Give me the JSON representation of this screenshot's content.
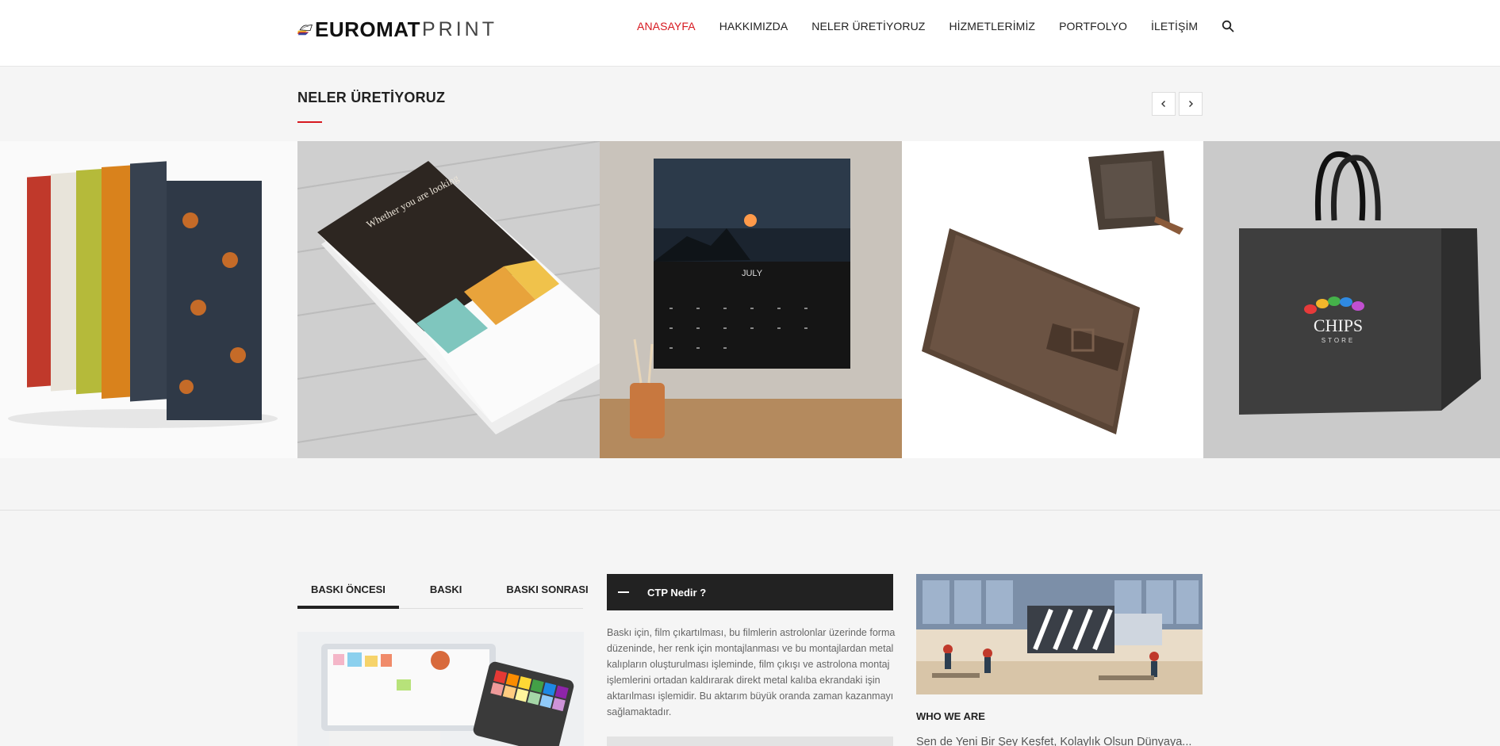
{
  "header": {
    "logo": {
      "bold": "EUROMAT",
      "light": "PRINT"
    },
    "nav": [
      {
        "label": "ANASAYFA",
        "active": true
      },
      {
        "label": "HAKKIMIZDA",
        "active": false
      },
      {
        "label": "NELER ÜRETİYORUZ",
        "active": false
      },
      {
        "label": "HİZMETLERİMİZ",
        "active": false
      },
      {
        "label": "PORTFOLYO",
        "active": false
      },
      {
        "label": "İLETİŞİM",
        "active": false
      }
    ],
    "search_icon": "search-icon"
  },
  "products": {
    "title": "NELER ÜRETİYORUZ",
    "prev_icon": "chevron-left-icon",
    "next_icon": "chevron-right-icon",
    "slides": [
      {
        "subject": "books"
      },
      {
        "subject": "brochures"
      },
      {
        "subject": "wall-calendar",
        "month": "JULY"
      },
      {
        "subject": "leather-notebook"
      },
      {
        "subject": "shopping-bag",
        "brand": "CHIPS",
        "brand_sub": "STORE"
      }
    ]
  },
  "services": {
    "tabs": [
      {
        "label": "BASKI ÖNCESI",
        "active": true
      },
      {
        "label": "BASKI",
        "active": false
      },
      {
        "label": "BASKI SONRASI",
        "active": false
      }
    ]
  },
  "faq": {
    "title": "CTP Nedir ?",
    "body": "Baskı için, film çıkartılması, bu filmlerin astrolonlar üzerinde forma düzeninde, her renk için montajlanması ve bu montajlardan metal kalıpların oluşturulması işleminde, film çıkışı ve astrolona montaj işlemlerini ortadan kaldırarak direkt metal kalıba ekrandaki işin aktarılması işlemidir. Bu aktarım büyük oranda zaman kazanmayı sağlamaktadır."
  },
  "about": {
    "title": "WHO WE ARE",
    "text": "Sen de Yeni Bir Şey Keşfet, Kolaylık Olsun Dünyaya..."
  },
  "colors": {
    "accent": "#d71920",
    "dark": "#222222",
    "page_bg": "#f5f5f5"
  }
}
